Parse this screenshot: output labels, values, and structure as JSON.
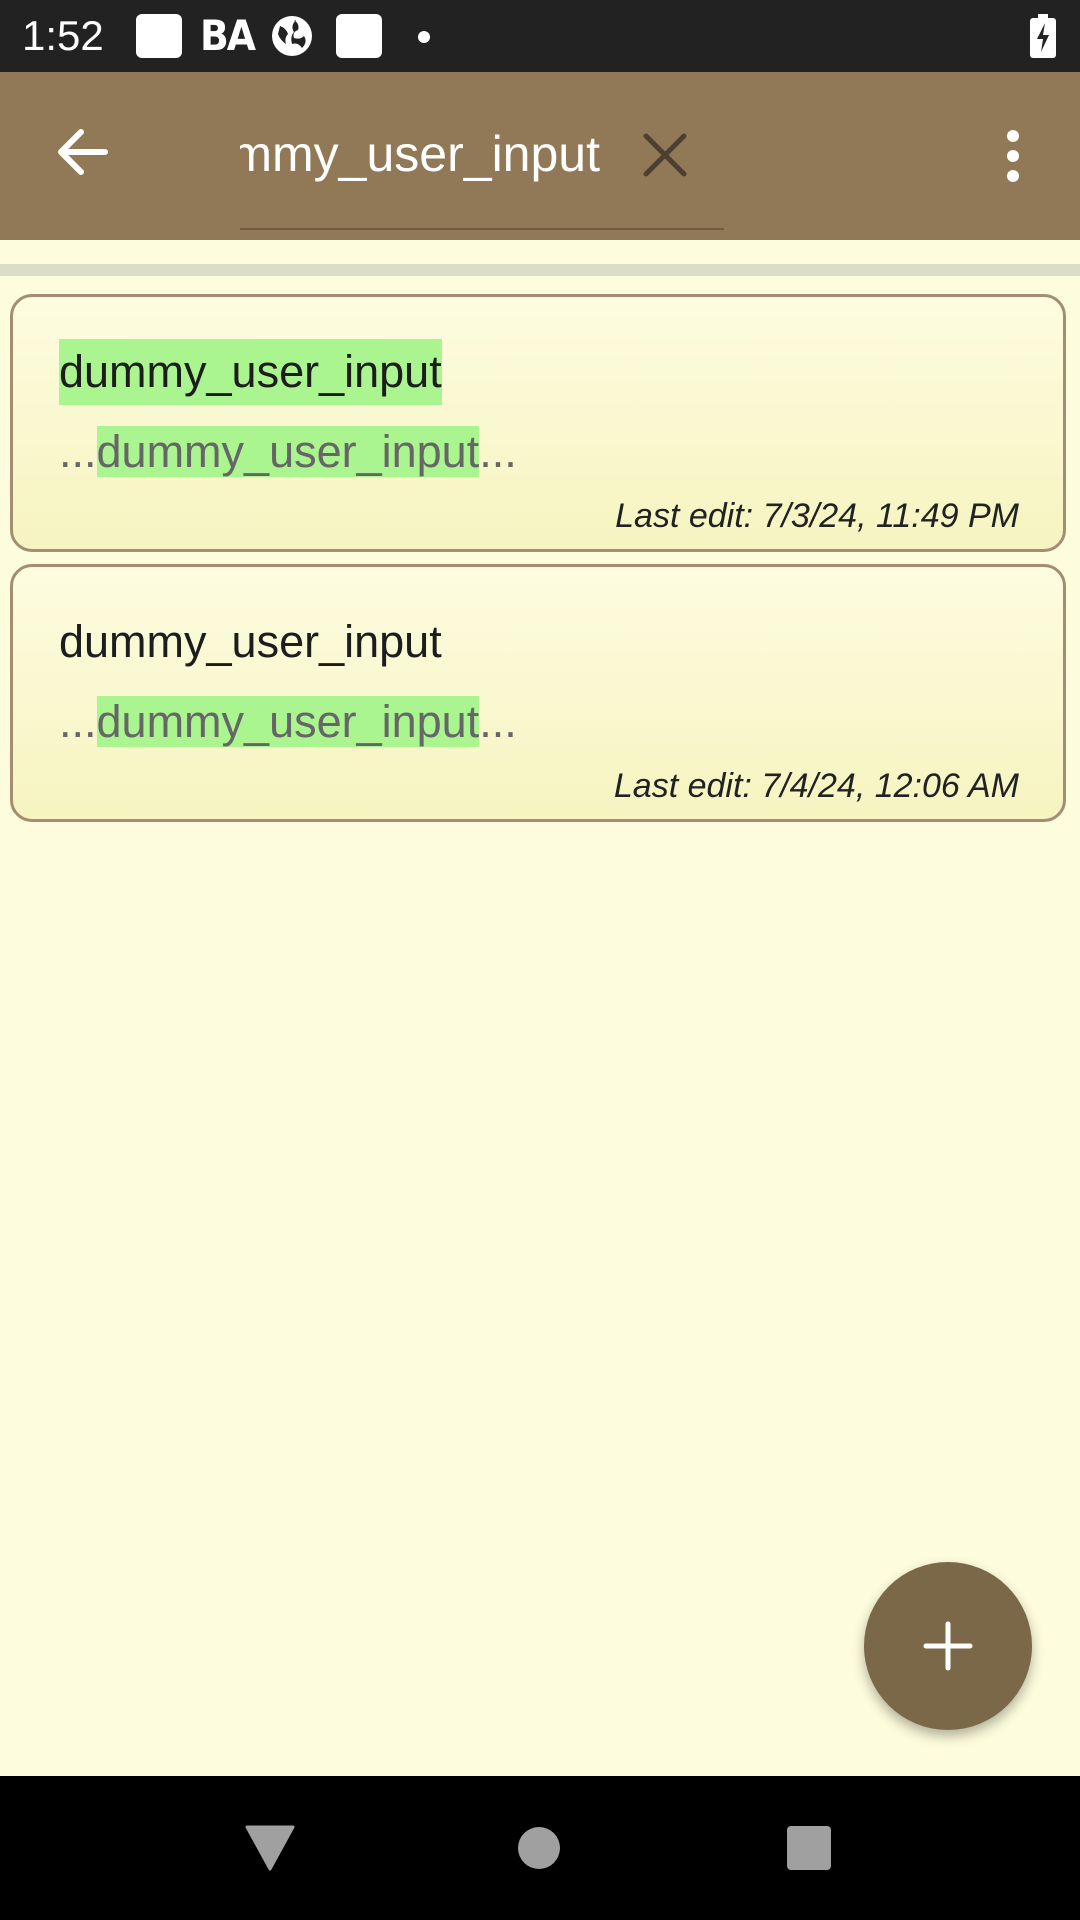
{
  "status_bar": {
    "time": "1:52",
    "indicator_text": "BA"
  },
  "app_bar": {
    "search_value": "dummy_user_input",
    "colors": {
      "background": "#917957",
      "icon": "#ffffff"
    }
  },
  "notes": [
    {
      "title": "dummy_user_input",
      "title_highlighted": true,
      "snippet_prefix": "...",
      "snippet_match": "dummy_user_input",
      "snippet_suffix": "...",
      "last_edit": "Last edit: 7/3/24, 11:49 PM"
    },
    {
      "title": "dummy_user_input",
      "title_highlighted": false,
      "snippet_prefix": "...",
      "snippet_match": "dummy_user_input",
      "snippet_suffix": "...",
      "last_edit": "Last edit: 7/4/24, 12:06 AM"
    }
  ],
  "fab": {
    "icon": "plus-icon",
    "color": "#7a6848"
  },
  "nav_bar": {
    "icons": [
      "back-triangle-icon",
      "home-circle-icon",
      "recents-square-icon"
    ]
  },
  "theme": {
    "page_background": "#fdfcdc",
    "highlight": "#aaf590",
    "card_border": "#a48d73"
  }
}
